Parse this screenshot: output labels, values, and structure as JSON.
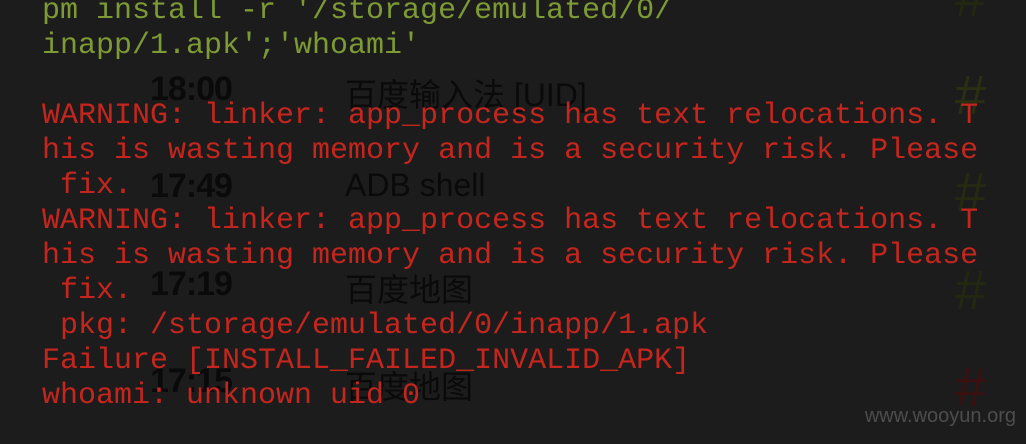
{
  "background_list": [
    {
      "time": "18:00",
      "app": "百度输入法 [UID]",
      "icon_color": "#2a2f12"
    },
    {
      "time": "17:49",
      "app": "ADB shell",
      "icon_color": "#252a10"
    },
    {
      "time": "17:19",
      "app": "百度地图",
      "icon_color": "#22270f"
    },
    {
      "time": "17:15",
      "app": "百度地图",
      "icon_color": "#3a1010"
    }
  ],
  "terminal": {
    "command_lines": [
      "pm install -r '/storage/emulated/0/",
      "inapp/1.apk';'whoami'"
    ],
    "output_lines": [
      "WARNING: linker: app_process has text relocations. T",
      "his is wasting memory and is a security risk. Please",
      " fix.",
      "WARNING: linker: app_process has text relocations. T",
      "his is wasting memory and is a security risk. Please",
      " fix.",
      " pkg: /storage/emulated/0/inapp/1.apk",
      "Failure [INSTALL_FAILED_INVALID_APK]",
      "whoami: unknown uid 0"
    ],
    "command_color": "#7e9a35",
    "error_color": "#c4261e"
  },
  "watermark": "www.wooyun.org"
}
